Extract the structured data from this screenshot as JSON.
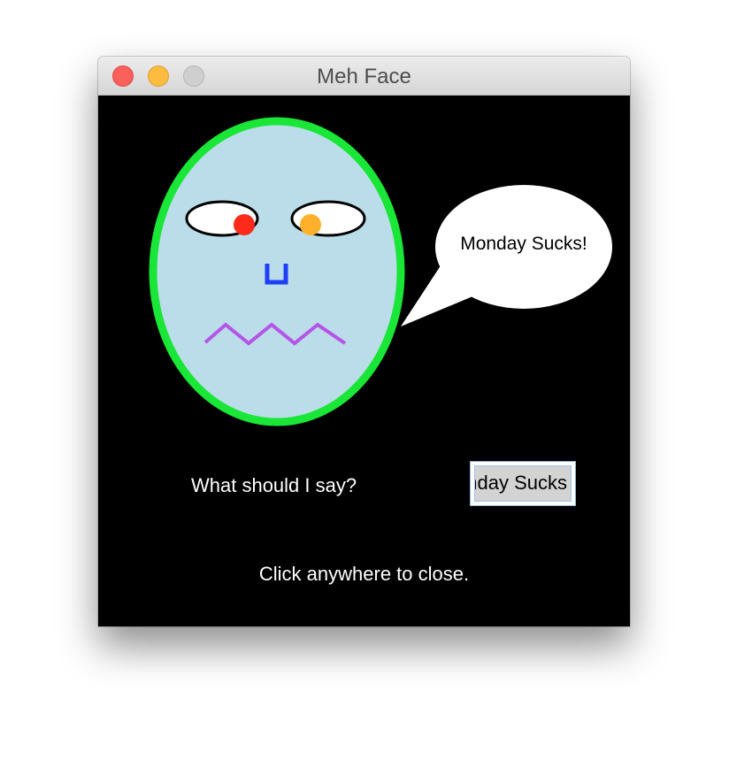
{
  "window": {
    "title": "Meh Face"
  },
  "bubble": {
    "text": "Monday Sucks!"
  },
  "prompt": {
    "label": "What should I say?"
  },
  "speech_input": {
    "value": "Monday Sucks!"
  },
  "hint": {
    "text": "Click anywhere to close."
  },
  "colors": {
    "background": "#000000",
    "face_fill": "#bbdde9",
    "face_outline": "#19e636",
    "left_pupil": "#ff2a1a",
    "right_pupil": "#ffb12c",
    "nose": "#1e3ff5",
    "mouth": "#b455e8"
  }
}
